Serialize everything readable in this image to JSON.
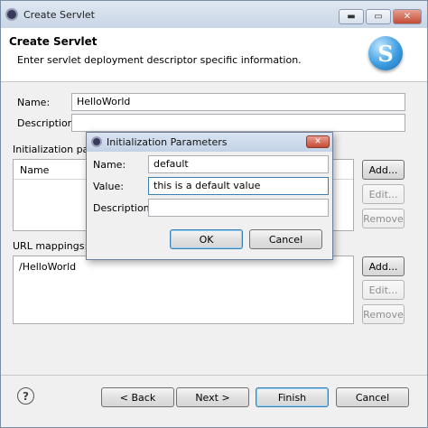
{
  "window": {
    "title": "Create Servlet",
    "minimize": "▬",
    "maximize": "▭",
    "close": "✕"
  },
  "header": {
    "title": "Create Servlet",
    "description": "Enter servlet deployment descriptor specific information.",
    "logo_letter": "S",
    "logo_icon": "s-logo-icon"
  },
  "form": {
    "name_label": "Name:",
    "name_value": "HelloWorld",
    "description_label": "Description:",
    "description_value": "",
    "init_params_label": "Initialization para",
    "init_params_column": "Name",
    "url_mappings_label": "URL mappings:",
    "url_mappings": [
      "/HelloWorld"
    ]
  },
  "side_buttons": {
    "add": "Add...",
    "edit": "Edit...",
    "remove": "Remove"
  },
  "footer": {
    "help_icon": "?",
    "back": "< Back",
    "next": "Next >",
    "finish": "Finish",
    "cancel": "Cancel"
  },
  "dialog": {
    "title": "Initialization Parameters",
    "close": "✕",
    "name_label": "Name:",
    "name_value": "default",
    "value_label": "Value:",
    "value_value": "this is a default value",
    "description_label": "Description:",
    "description_value": "",
    "ok": "OK",
    "cancel": "Cancel"
  },
  "colors": {
    "accent": "#3c7fb1",
    "close_red": "#c44a33"
  }
}
